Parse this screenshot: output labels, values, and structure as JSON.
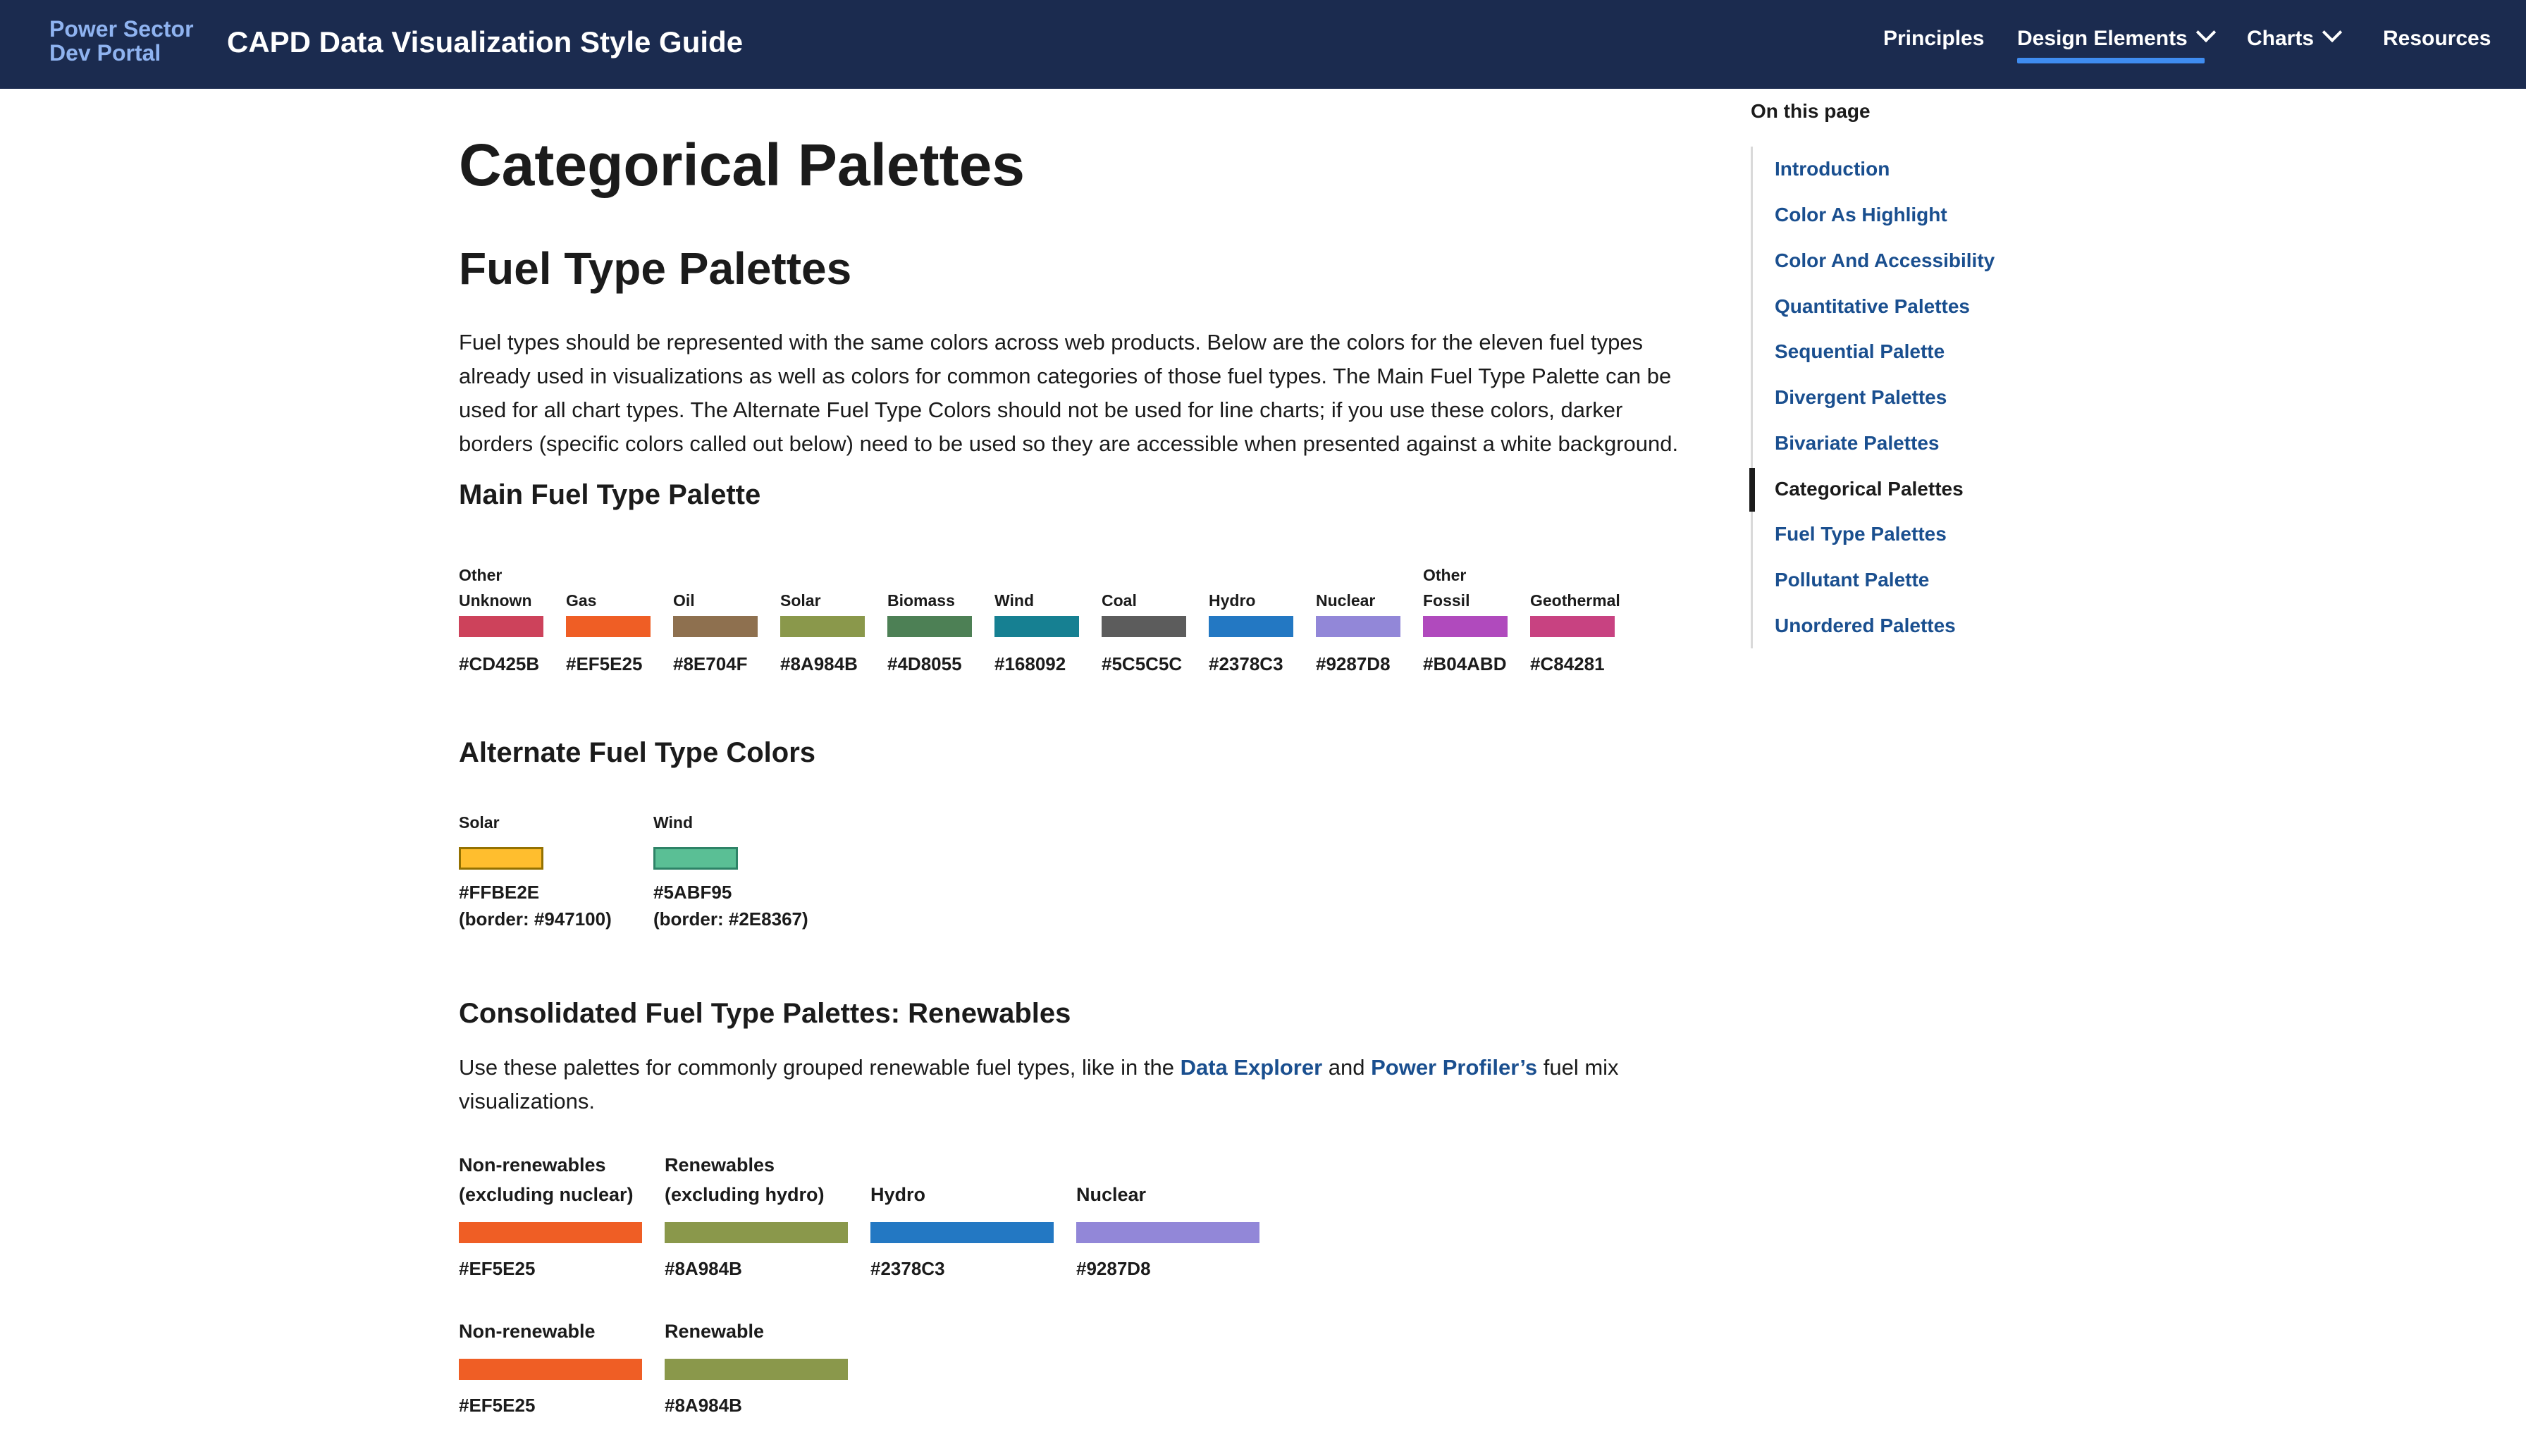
{
  "header": {
    "brand_line1": "Power Sector",
    "brand_line2": "Dev Portal",
    "site_title": "CAPD Data Visualization Style Guide",
    "nav": [
      "Principles",
      "Design Elements",
      "Charts",
      "Resources"
    ]
  },
  "page": {
    "title": "Categorical Palettes",
    "section_title": "Fuel Type Palettes",
    "intro": "Fuel types should be represented with the same colors across web products. Below are the colors for the eleven fuel types already used in visualizations as well as colors for common categories of those fuel types. The Main Fuel Type Palette can be used for all chart types. The Alternate Fuel Type Colors should not be used for line charts; if you use these colors, darker borders (specific colors called out below) need to be used so they are accessible when presented against a white background."
  },
  "main_palette": {
    "title": "Main Fuel Type Palette",
    "swatches": [
      {
        "label": "Other Unknown",
        "hex": "#CD425B"
      },
      {
        "label": "Gas",
        "hex": "#EF5E25"
      },
      {
        "label": "Oil",
        "hex": "#8E704F"
      },
      {
        "label": "Solar",
        "hex": "#8A984B"
      },
      {
        "label": "Biomass",
        "hex": "#4D8055"
      },
      {
        "label": "Wind",
        "hex": "#168092"
      },
      {
        "label": "Coal",
        "hex": "#5C5C5C"
      },
      {
        "label": "Hydro",
        "hex": "#2378C3"
      },
      {
        "label": "Nuclear",
        "hex": "#9287D8"
      },
      {
        "label": "Other Fossil",
        "hex": "#B04ABD"
      },
      {
        "label": "Geothermal",
        "hex": "#C84281"
      }
    ]
  },
  "alternate_palette": {
    "title": "Alternate Fuel Type Colors",
    "swatches": [
      {
        "label": "Solar",
        "hex": "#FFBE2E",
        "border": "#947100",
        "border_text": "(border: #947100)"
      },
      {
        "label": "Wind",
        "hex": "#5ABF95",
        "border": "#2E8367",
        "border_text": "(border: #2E8367)"
      }
    ]
  },
  "renewables": {
    "title": "Consolidated Fuel Type Palettes: Renewables",
    "text_before": "Use these palettes for commonly grouped renewable fuel types, like in the ",
    "link1": "Data Explorer",
    "text_mid": " and ",
    "link2": "Power Profiler’s",
    "text_after": " fuel mix visualizations.",
    "row1": [
      {
        "label_line1": "Non-renewables",
        "label_line2": "(excluding nuclear)",
        "hex": "#EF5E25"
      },
      {
        "label_line1": "Renewables",
        "label_line2": "(excluding hydro)",
        "hex": "#8A984B"
      },
      {
        "label_line1": "",
        "label_line2": "Hydro",
        "hex": "#2378C3"
      },
      {
        "label_line1": "",
        "label_line2": "Nuclear",
        "hex": "#9287D8"
      }
    ],
    "row2": [
      {
        "label": "Non-renewable",
        "hex": "#EF5E25"
      },
      {
        "label": "Renewable",
        "hex": "#8A984B"
      }
    ]
  },
  "toc": {
    "title": "On this page",
    "items": [
      "Introduction",
      "Color As Highlight",
      "Color And Accessibility",
      "Quantitative Palettes",
      "Sequential Palette",
      "Divergent Palettes",
      "Bivariate Palettes",
      "Categorical Palettes",
      "Fuel Type Palettes",
      "Pollutant Palette",
      "Unordered Palettes"
    ],
    "active": "Categorical Palettes"
  }
}
